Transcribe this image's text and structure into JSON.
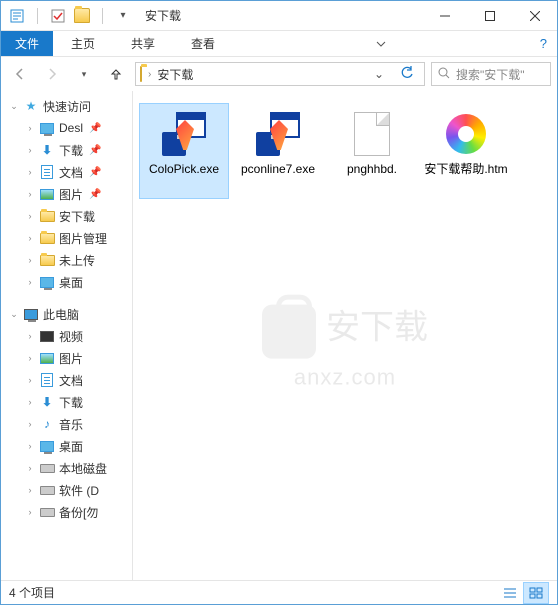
{
  "window": {
    "title": "安下载"
  },
  "ribbon": {
    "file": "文件",
    "tabs": [
      "主页",
      "共享",
      "查看"
    ]
  },
  "address": {
    "crumbs": [
      "安下载"
    ],
    "search_placeholder": "搜索\"安下载\""
  },
  "sidebar": {
    "quick_access": {
      "label": "快速访问"
    },
    "quick_items": [
      {
        "label": "Desl",
        "pinned": true,
        "icon": "desktop"
      },
      {
        "label": "下载",
        "pinned": true,
        "icon": "download"
      },
      {
        "label": "文档",
        "pinned": true,
        "icon": "document"
      },
      {
        "label": "图片",
        "pinned": true,
        "icon": "picture"
      },
      {
        "label": "安下载",
        "pinned": false,
        "icon": "folder"
      },
      {
        "label": "图片管理",
        "pinned": false,
        "icon": "folder"
      },
      {
        "label": "未上传",
        "pinned": false,
        "icon": "folder"
      },
      {
        "label": "桌面",
        "pinned": false,
        "icon": "desktop"
      }
    ],
    "this_pc": {
      "label": "此电脑"
    },
    "pc_items": [
      {
        "label": "视频",
        "icon": "video"
      },
      {
        "label": "图片",
        "icon": "picture"
      },
      {
        "label": "文档",
        "icon": "document"
      },
      {
        "label": "下载",
        "icon": "download"
      },
      {
        "label": "音乐",
        "icon": "music"
      },
      {
        "label": "桌面",
        "icon": "desktop"
      },
      {
        "label": "本地磁盘",
        "icon": "drive"
      },
      {
        "label": "软件 (D",
        "icon": "drive"
      },
      {
        "label": "备份[勿",
        "icon": "drive"
      }
    ]
  },
  "files": [
    {
      "name": "ColoPick.exe",
      "type": "exe",
      "selected": true
    },
    {
      "name": "pconline7.exe",
      "type": "exe",
      "selected": false
    },
    {
      "name": "pnghhbd.",
      "type": "blank",
      "selected": false
    },
    {
      "name": "安下载帮助.htm",
      "type": "color",
      "selected": false
    }
  ],
  "status": {
    "count_label": "4 个项目"
  },
  "watermark": {
    "line1": "安下载",
    "line2": "anxz.com"
  }
}
